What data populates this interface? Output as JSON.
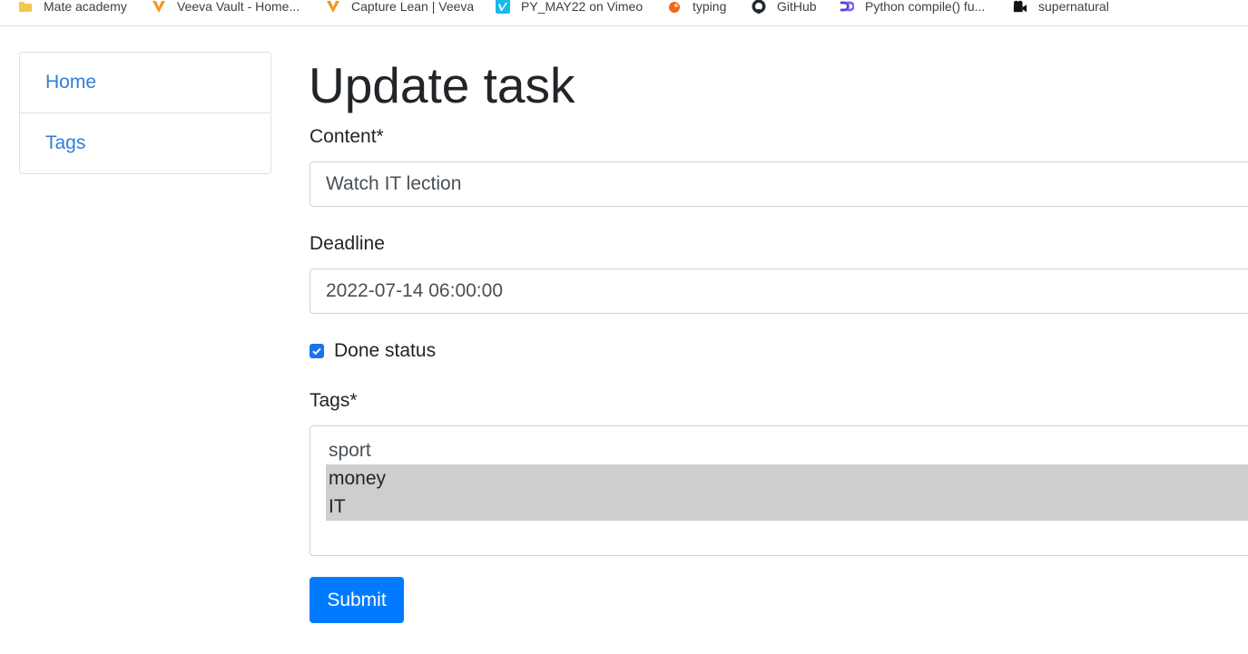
{
  "bookmarks": [
    {
      "label": "Mate academy",
      "icon": "folder-icon"
    },
    {
      "label": "Veeva Vault - Home...",
      "icon": "veeva-icon"
    },
    {
      "label": "Capture Lean | Veeva",
      "icon": "veeva-icon"
    },
    {
      "label": "PY_MAY22 on Vimeo",
      "icon": "vimeo-icon"
    },
    {
      "label": "typing",
      "icon": "typing-icon"
    },
    {
      "label": "GitHub",
      "icon": "github-icon"
    },
    {
      "label": "Python compile() fu...",
      "icon": "site-icon"
    },
    {
      "label": "supernatural",
      "icon": "camera-icon"
    }
  ],
  "sidebar": {
    "items": [
      {
        "label": "Home"
      },
      {
        "label": "Tags"
      }
    ]
  },
  "page": {
    "title": "Update task"
  },
  "form": {
    "content_label": "Content*",
    "content_value": "Watch IT lection",
    "deadline_label": "Deadline",
    "deadline_value": "2022-07-14 06:00:00",
    "done_label": "Done status",
    "done_checked": true,
    "tags_label": "Tags*",
    "tags_options": [
      {
        "label": "sport",
        "selected": false
      },
      {
        "label": "money",
        "selected": true
      },
      {
        "label": "IT",
        "selected": true
      }
    ],
    "submit_label": "Submit"
  },
  "colors": {
    "link": "#2f7ed8",
    "primary": "#007bff",
    "selected_option": "#cecece"
  }
}
